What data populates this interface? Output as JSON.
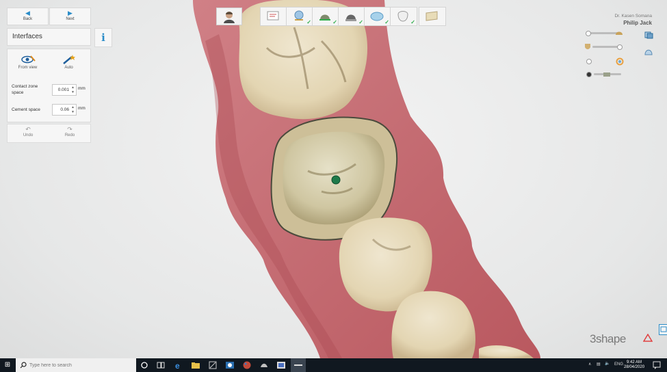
{
  "nav": {
    "back": "Back",
    "next": "Next"
  },
  "panel": {
    "title": "Interfaces",
    "info_icon": "i",
    "modes": [
      {
        "label": "From view",
        "icon": "eye-view-icon"
      },
      {
        "label": "Auto",
        "icon": "magic-wand-icon"
      }
    ],
    "contact_zone": {
      "label": "Contact zone space",
      "value": "0.001",
      "unit": "mm"
    },
    "cement": {
      "label": "Cement space",
      "value": "0.06",
      "unit": "mm"
    },
    "undo": "Undo",
    "redo": "Redo"
  },
  "user": {
    "doctor": "Dr. Kasen Somana",
    "patient": "Philip Jack"
  },
  "workflow_steps": [
    {
      "icon": "patient-photo-icon",
      "done": false
    },
    {
      "icon": "order-form-icon",
      "done": false
    },
    {
      "icon": "scan-icon",
      "done": true
    },
    {
      "icon": "margin-line-icon",
      "done": true
    },
    {
      "icon": "die-icon",
      "done": true
    },
    {
      "icon": "insertion-direction-icon",
      "done": true
    },
    {
      "icon": "crown-design-icon",
      "done": true
    },
    {
      "icon": "mill-icon",
      "done": false
    }
  ],
  "logo": "3shape",
  "taskbar": {
    "search_placeholder": "Type here to search",
    "language": "ENG",
    "time": "9:42 AM",
    "date": "28/04/2020"
  },
  "colors": {
    "accent": "#2a8cc8",
    "check": "#2fae4b",
    "gingiva": "#c46a6f",
    "tooth": "#e8dcc0",
    "point": "#1f7a4a",
    "taskbar": "#101820"
  }
}
